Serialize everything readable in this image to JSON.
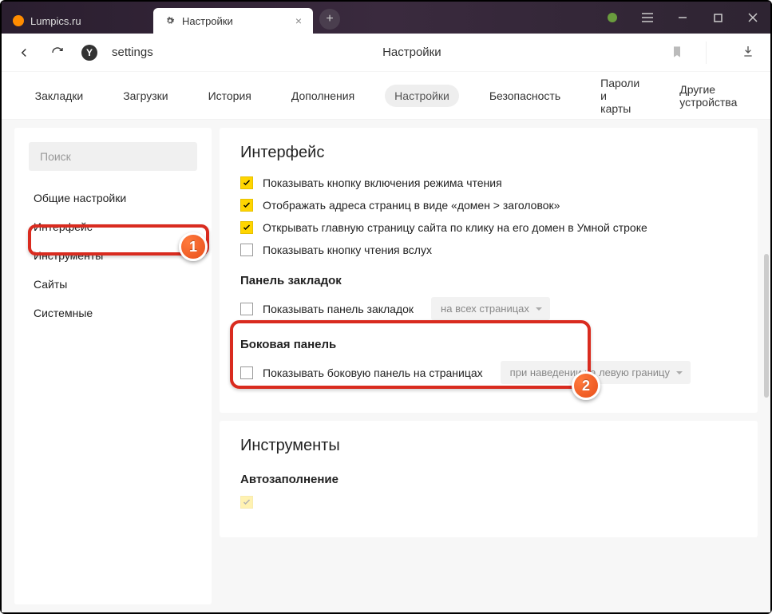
{
  "titlebar": {
    "tabs": [
      {
        "title": "Lumpics.ru",
        "active": false
      },
      {
        "title": "Настройки",
        "active": true
      }
    ]
  },
  "addressbar": {
    "url": "settings",
    "page_title": "Настройки"
  },
  "topnav": {
    "items": [
      "Закладки",
      "Загрузки",
      "История",
      "Дополнения",
      "Настройки",
      "Безопасность",
      "Пароли и карты",
      "Другие устройства"
    ],
    "active_index": 4
  },
  "sidebar": {
    "search_placeholder": "Поиск",
    "items": [
      "Общие настройки",
      "Интерфейс",
      "Инструменты",
      "Сайты",
      "Системные"
    ],
    "active_index": 1
  },
  "sections": {
    "interface": {
      "title": "Интерфейс",
      "checks": [
        {
          "label": "Показывать кнопку включения режима чтения",
          "checked": true
        },
        {
          "label": "Отображать адреса страниц в виде «домен > заголовок»",
          "checked": true
        },
        {
          "label": "Открывать главную страницу сайта по клику на его домен в Умной строке",
          "checked": true
        },
        {
          "label": "Показывать кнопку чтения вслух",
          "checked": false
        }
      ],
      "bookmarks_panel": {
        "title": "Панель закладок",
        "check_label": "Показывать панель закладок",
        "check_checked": false,
        "dropdown": "на всех страницах"
      },
      "side_panel": {
        "title": "Боковая панель",
        "check_label": "Показывать боковую панель на страницах",
        "check_checked": false,
        "dropdown": "при наведении на левую границу"
      }
    },
    "tools": {
      "title": "Инструменты",
      "autofill_title": "Автозаполнение"
    }
  },
  "badges": {
    "one": "1",
    "two": "2"
  }
}
